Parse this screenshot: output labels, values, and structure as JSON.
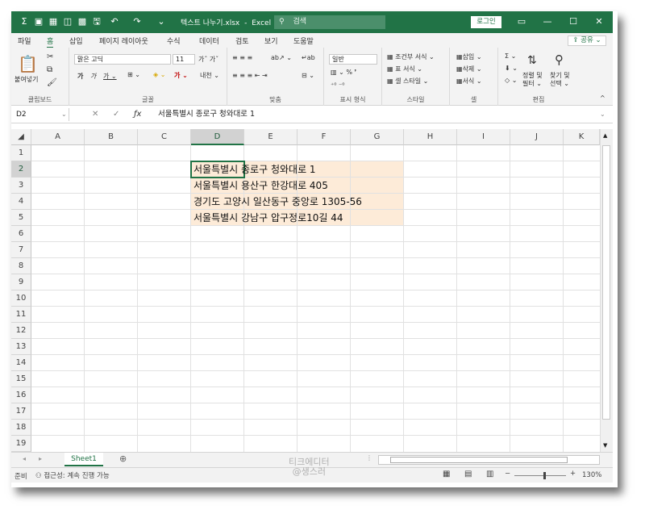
{
  "title": {
    "filename": "텍스트 나누기.xlsx",
    "separator": "-",
    "app": "Excel",
    "search_placeholder": "검색",
    "login": "로그인"
  },
  "menu": [
    "파일",
    "홈",
    "삽입",
    "페이지 레이아웃",
    "수식",
    "데이터",
    "검토",
    "보기",
    "도움말"
  ],
  "active_menu": "홈",
  "share": "공유",
  "ribbon": {
    "paste": "붙여넣기",
    "clipboard": "클립보드",
    "font_name": "맑은 고딕",
    "font_size": "11",
    "font_group": "글꼴",
    "align_group": "맞춤",
    "number_format": "일반",
    "number_group": "표시 형식",
    "cond_format": "조건부 서식",
    "table_format": "표 서식",
    "cell_style": "셀 스타일",
    "style_group": "스타일",
    "insert": "삽입",
    "delete": "삭제",
    "format": "서식",
    "cells_group": "셀",
    "sort_filter_1": "정렬 및",
    "sort_filter_2": "필터",
    "find_select_1": "찾기 및",
    "find_select_2": "선택",
    "edit_group": "편집"
  },
  "formula_bar": {
    "name_box": "D2",
    "content": "서울특별시 종로구 청와대로 1"
  },
  "columns": [
    "A",
    "B",
    "C",
    "D",
    "E",
    "F",
    "G",
    "H",
    "I",
    "J",
    "K"
  ],
  "rows": [
    "1",
    "2",
    "3",
    "4",
    "5",
    "6",
    "7",
    "8",
    "9",
    "10",
    "11",
    "12",
    "13",
    "14",
    "15",
    "16",
    "17",
    "18",
    "19"
  ],
  "cells": [
    "서울특별시 종로구 청와대로 1",
    "서울특별시 용산구 한강대로 405",
    "경기도 고양시 일산동구 중앙로 1305-56",
    "서울특별시 강남구 압구정로10길 44"
  ],
  "sheet_tab": "Sheet1",
  "status": {
    "ready": "준비",
    "accessibility": "접근성: 계속 진행 가능",
    "zoom": "130%",
    "watermark_1": "티크에디터",
    "watermark_2": "@생스러"
  },
  "colors": {
    "accent": "#217346",
    "highlight": "#fdebd8"
  }
}
